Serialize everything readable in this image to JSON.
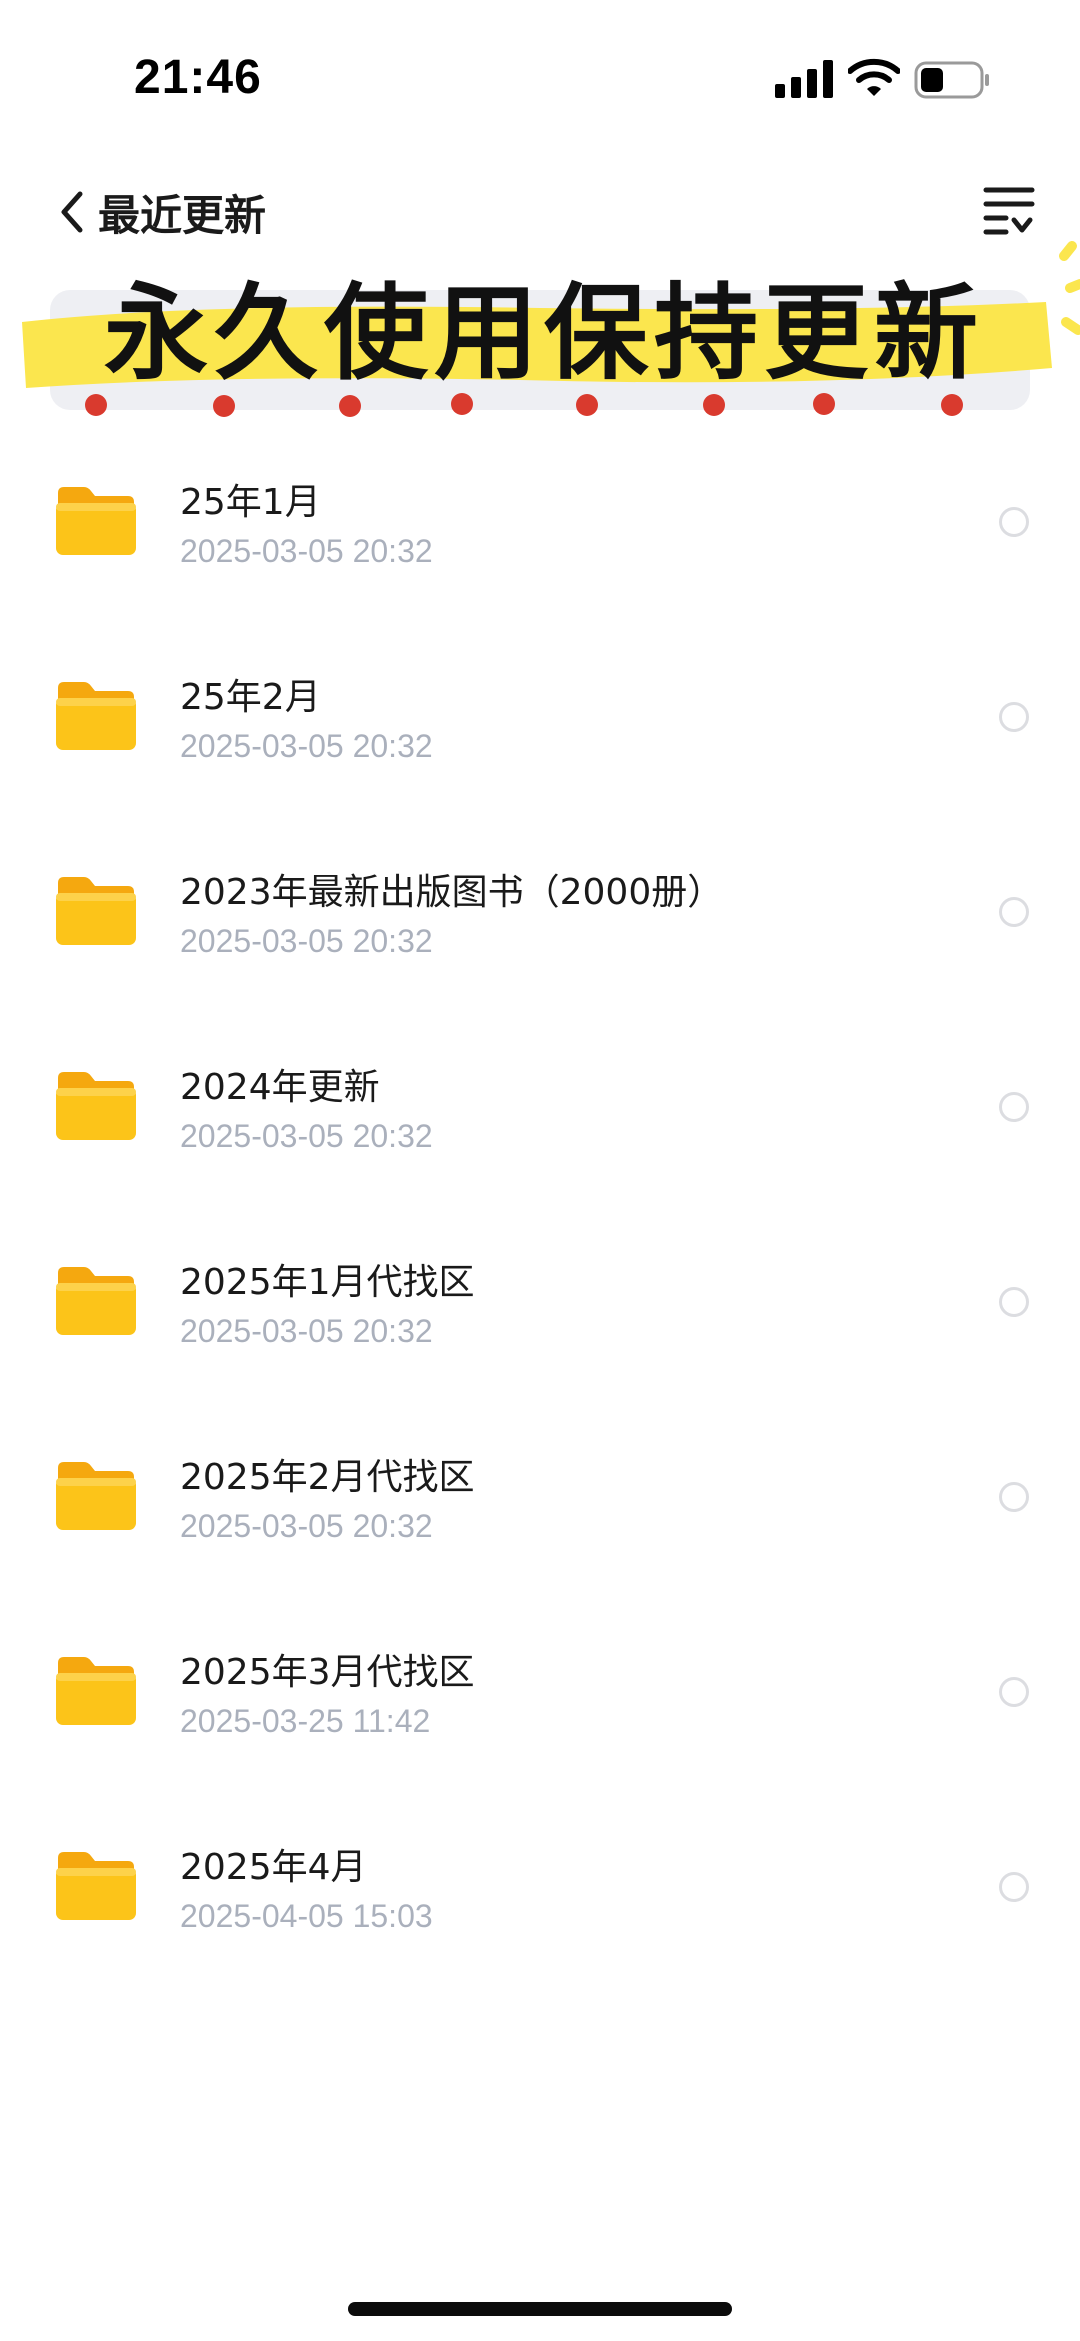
{
  "status_bar": {
    "time": "21:46",
    "signal_icon": "cellular-signal-icon",
    "wifi_icon": "wifi-icon",
    "battery_icon": "battery-low-icon"
  },
  "nav": {
    "back_icon": "chevron-left-icon",
    "title": "最近更新",
    "menu_icon": "list-menu-icon"
  },
  "banner": {
    "text": "永久使用保持更新",
    "highlight_color": "#FBE64E",
    "dot_color": "#D93A2E"
  },
  "files": [
    {
      "name": "25年1月",
      "date": "2025-03-05 20:32"
    },
    {
      "name": "25年2月",
      "date": "2025-03-05 20:32"
    },
    {
      "name": "2023年最新出版图书（2000册）",
      "date": "2025-03-05 20:32"
    },
    {
      "name": "2024年更新",
      "date": "2025-03-05 20:32"
    },
    {
      "name": "2025年1月代找区",
      "date": "2025-03-05 20:32"
    },
    {
      "name": "2025年2月代找区",
      "date": "2025-03-05 20:32"
    },
    {
      "name": "2025年3月代找区",
      "date": "2025-03-25 11:42"
    },
    {
      "name": "2025年4月",
      "date": "2025-04-05 15:03"
    }
  ],
  "colors": {
    "folder": "#FCC419",
    "date_text": "#AAB0BC",
    "radio_border": "#DCDDE1"
  }
}
